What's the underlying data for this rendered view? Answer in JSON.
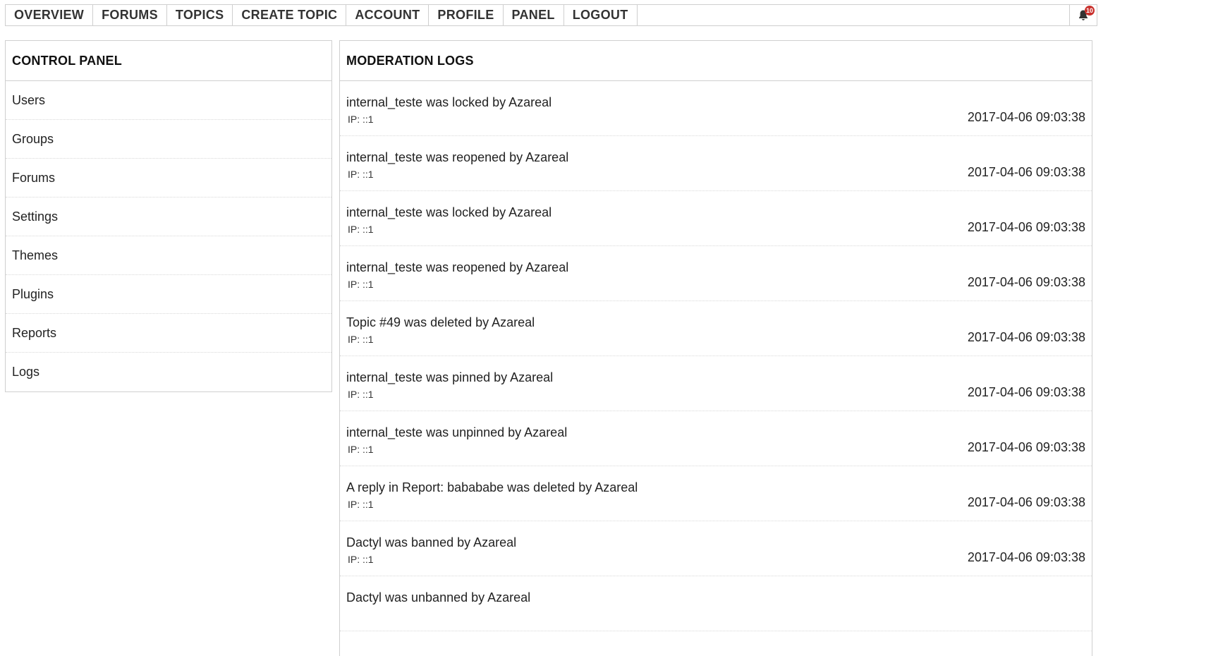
{
  "nav": {
    "items": [
      {
        "label": "OVERVIEW",
        "name": "nav-overview"
      },
      {
        "label": "FORUMS",
        "name": "nav-forums"
      },
      {
        "label": "TOPICS",
        "name": "nav-topics"
      },
      {
        "label": "CREATE TOPIC",
        "name": "nav-create-topic"
      },
      {
        "label": "ACCOUNT",
        "name": "nav-account"
      },
      {
        "label": "PROFILE",
        "name": "nav-profile"
      },
      {
        "label": "PANEL",
        "name": "nav-panel"
      },
      {
        "label": "LOGOUT",
        "name": "nav-logout"
      }
    ],
    "notifications": {
      "icon": "bell-icon",
      "count": "10",
      "badge_color": "#c9302c"
    }
  },
  "control_panel": {
    "title": "CONTROL PANEL",
    "items": [
      {
        "label": "Users"
      },
      {
        "label": "Groups"
      },
      {
        "label": "Forums"
      },
      {
        "label": "Settings"
      },
      {
        "label": "Themes"
      },
      {
        "label": "Plugins"
      },
      {
        "label": "Reports"
      },
      {
        "label": "Logs"
      }
    ]
  },
  "moderation_logs": {
    "title": "MODERATION LOGS",
    "ip_label": "IP: ",
    "entries": [
      {
        "action": "internal_teste was locked by Azareal",
        "ip": "::1",
        "time": "2017-04-06 09:03:38"
      },
      {
        "action": "internal_teste was reopened by Azareal",
        "ip": "::1",
        "time": "2017-04-06 09:03:38"
      },
      {
        "action": "internal_teste was locked by Azareal",
        "ip": "::1",
        "time": "2017-04-06 09:03:38"
      },
      {
        "action": "internal_teste was reopened by Azareal",
        "ip": "::1",
        "time": "2017-04-06 09:03:38"
      },
      {
        "action": "Topic #49 was deleted by Azareal",
        "ip": "::1",
        "time": "2017-04-06 09:03:38"
      },
      {
        "action": "internal_teste was pinned by Azareal",
        "ip": "::1",
        "time": "2017-04-06 09:03:38"
      },
      {
        "action": "internal_teste was unpinned by Azareal",
        "ip": "::1",
        "time": "2017-04-06 09:03:38"
      },
      {
        "action": "A reply in Report: babababe was deleted by Azareal",
        "ip": "::1",
        "time": "2017-04-06 09:03:38"
      },
      {
        "action": "Dactyl was banned by Azareal",
        "ip": "::1",
        "time": "2017-04-06 09:03:38"
      },
      {
        "action": "Dactyl was unbanned by Azareal",
        "ip": "",
        "time": ""
      }
    ]
  }
}
